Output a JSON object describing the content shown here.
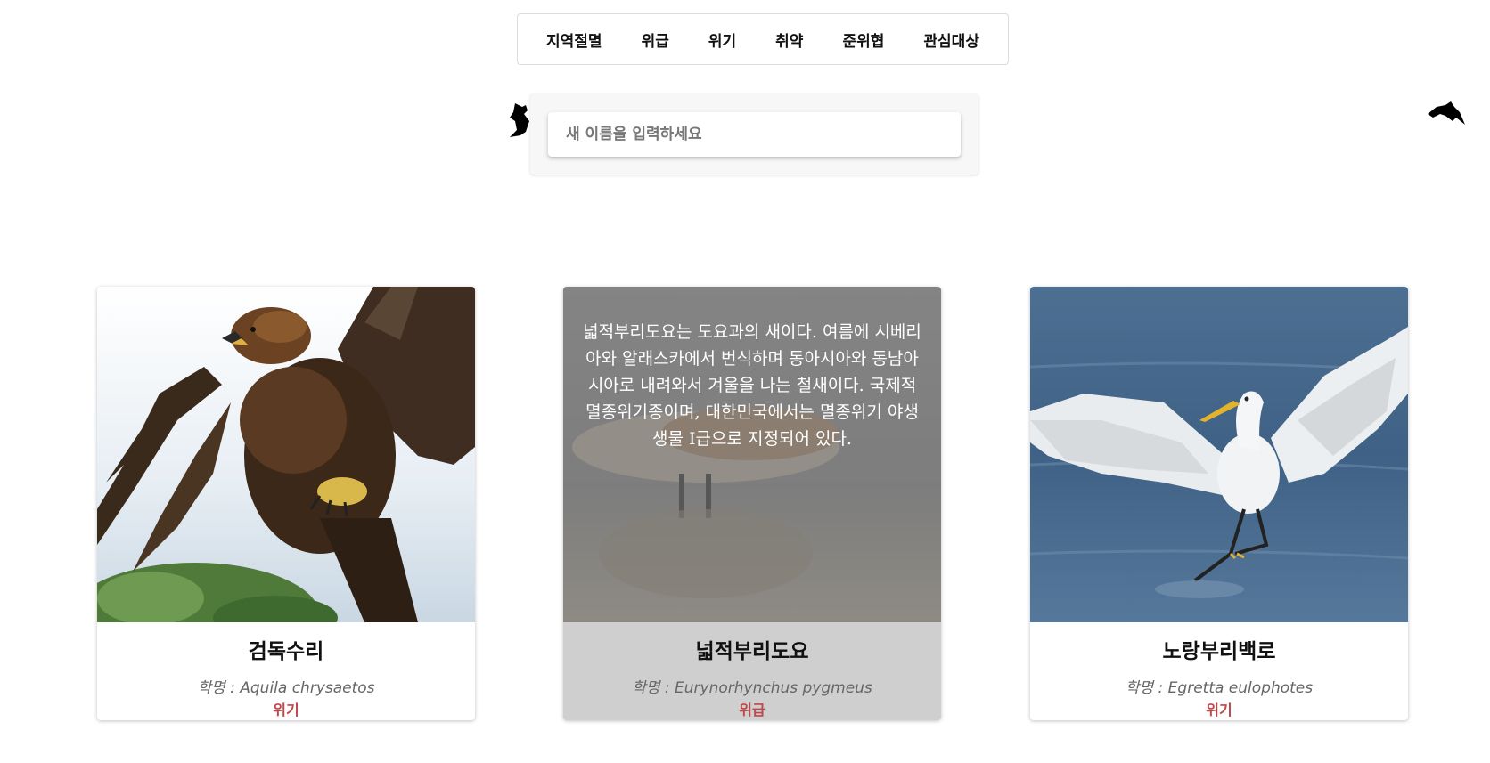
{
  "tabs": [
    "지역절멸",
    "위급",
    "위기",
    "취약",
    "준위협",
    "관심대상"
  ],
  "search": {
    "placeholder": "새 이름을 입력하세요"
  },
  "status_color": "#c0474a",
  "cards": [
    {
      "name": "검독수리",
      "scientific": "학명 : Aquila chrysaetos",
      "status": "위기",
      "image": "golden-eagle-photo"
    },
    {
      "name": "넓적부리도요",
      "scientific": "학명 : Eurynorhynchus pygmeus",
      "status": "위급",
      "image": "spoon-billed-sandpiper-photo",
      "description": "넓적부리도요는 도요과의 새이다. 여름에 시베리아와 알래스카에서 번식하며 동아시아와 동남아시아로 내려와서 겨울을 나는 철새이다. 국제적 멸종위기종이며, 대한민국에서는 멸종위기 야생생물 Ⅰ급으로 지정되어 있다."
    },
    {
      "name": "노랑부리백로",
      "scientific": "학명 : Egretta eulophotes",
      "status": "위기",
      "image": "chinese-egret-photo"
    }
  ]
}
